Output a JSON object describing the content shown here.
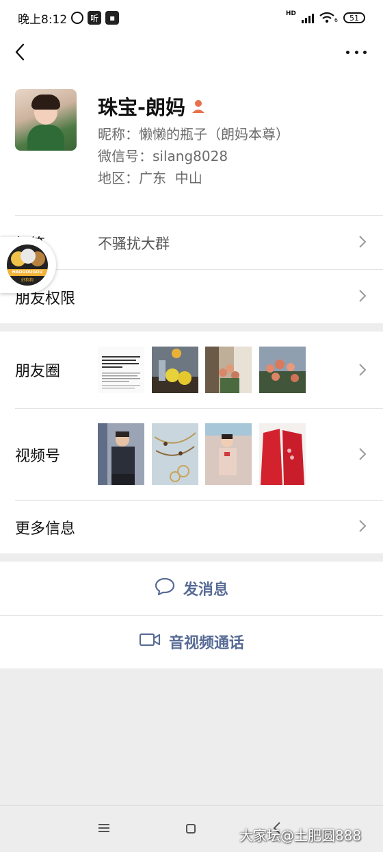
{
  "status_bar": {
    "time": "晚上8:12",
    "listen_badge": "听",
    "network_label": "HD",
    "wifi_sub": "6",
    "battery": "51"
  },
  "profile": {
    "display_name": "珠宝-朗妈",
    "nickname_label": "昵称：",
    "nickname": "懒懒的瓶子（朗妈本尊）",
    "wechat_id_label": "微信号：",
    "wechat_id": "silang8028",
    "region_label": "地区：",
    "region": "广东  中山"
  },
  "settings_rows": {
    "tags_label": "标签",
    "tags_value": "不骚扰大群",
    "permissions_label": "朋友权限"
  },
  "floating_badge": {
    "text": "HAOGOUGOU",
    "sub": "好狗狗"
  },
  "social": {
    "moments_label": "朋友圈",
    "channels_label": "视频号",
    "more_info_label": "更多信息"
  },
  "actions": {
    "message_label": "发消息",
    "call_label": "音视频通话"
  },
  "watermark": "大家坛@土肥圆888",
  "colors": {
    "link_blue": "#576b95",
    "background": "#ededed",
    "avatar_orange": "#e8704a"
  }
}
